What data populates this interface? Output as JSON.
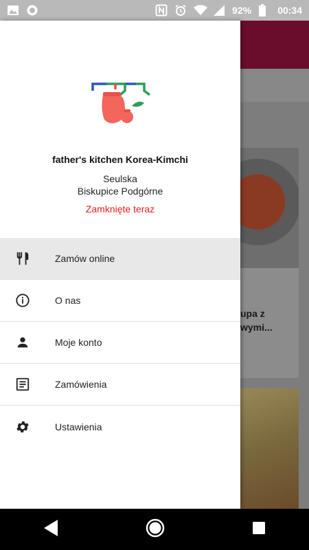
{
  "status_bar": {
    "battery": "92%",
    "time": "00:34"
  },
  "restaurant": {
    "name": "father's kitchen Korea-Kimchi",
    "address_line1": "Seulska",
    "address_line2": "Biskupice Podgórne",
    "status": "Zamknięte teraz",
    "status_color": "#e02020"
  },
  "menu": {
    "items": [
      {
        "label": "Zamów online",
        "icon": "restaurant-icon"
      },
      {
        "label": "O nas",
        "icon": "info-icon"
      },
      {
        "label": "Moje konto",
        "icon": "person-icon"
      },
      {
        "label": "Zamówienia",
        "icon": "receipt-icon"
      },
      {
        "label": "Ustawienia",
        "icon": "gear-icon"
      }
    ]
  },
  "background": {
    "card_text_line1": "upa z",
    "card_text_line2": "wymi...",
    "toolbar_color": "#6a0d2c"
  }
}
